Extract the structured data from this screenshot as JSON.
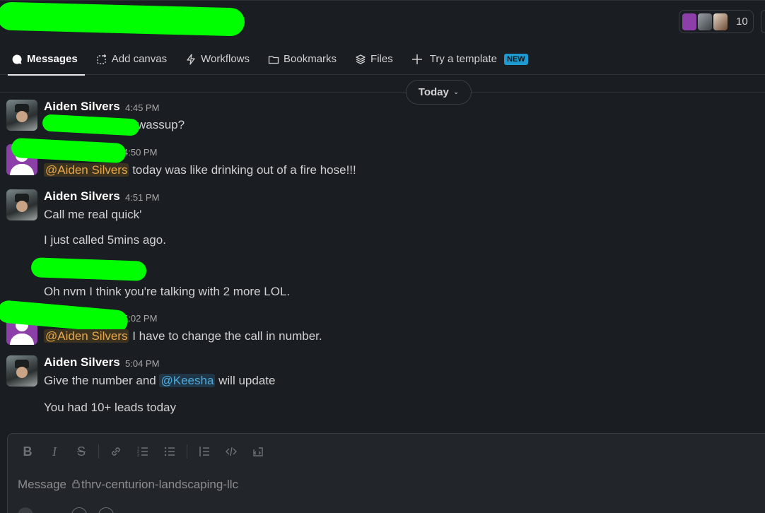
{
  "header": {
    "member_count": "10"
  },
  "tabs": [
    {
      "label": "Messages",
      "icon": "message-bubble-icon",
      "active": true
    },
    {
      "label": "Add canvas",
      "icon": "canvas-icon"
    },
    {
      "label": "Workflows",
      "icon": "workflow-bolt-icon"
    },
    {
      "label": "Bookmarks",
      "icon": "folder-icon"
    },
    {
      "label": "Files",
      "icon": "stack-icon"
    },
    {
      "label": "Try a template",
      "icon": "plus-icon",
      "badge": "NEW"
    }
  ],
  "day_divider": {
    "label": "Today"
  },
  "messages": [
    {
      "name": "Aiden Silvers",
      "time": "4:45 PM",
      "text": "wassup?"
    },
    {
      "time": "4:50 PM",
      "mention": "@Aiden Silvers",
      "text": " today was like drinking out of a fire hose!!!"
    },
    {
      "name": "Aiden Silvers",
      "time": "4:51 PM",
      "text": "Call me real quick'"
    },
    {
      "text": "I just called 5mins ago."
    },
    {
      "text": "Oh nvm I think you're talking with 2 more LOL."
    },
    {
      "time": "5:02 PM",
      "mention": "@Aiden Silvers",
      "text": " I have to change the call in number."
    },
    {
      "name": "Aiden Silvers",
      "time": "5:04 PM",
      "text_before": "Give the number and ",
      "mention": "@Keesha",
      "text_after": " will update"
    },
    {
      "text": "You had 10+ leads today"
    }
  ],
  "composer": {
    "placeholder_prefix": "Message ",
    "channel": "thrv-centurion-landscaping-llc",
    "toolbar": [
      "bold-icon",
      "italic-icon",
      "strikethrough-icon",
      "link-icon",
      "ordered-list-icon",
      "bulleted-list-icon",
      "blockquote-icon",
      "code-icon",
      "code-block-icon"
    ]
  },
  "colors": {
    "background": "#1a1d21",
    "mention_text": "#e8a84a",
    "mention_blue": "#4fa8dc",
    "new_badge": "#1d9bd1",
    "redaction": "#00ff00"
  }
}
